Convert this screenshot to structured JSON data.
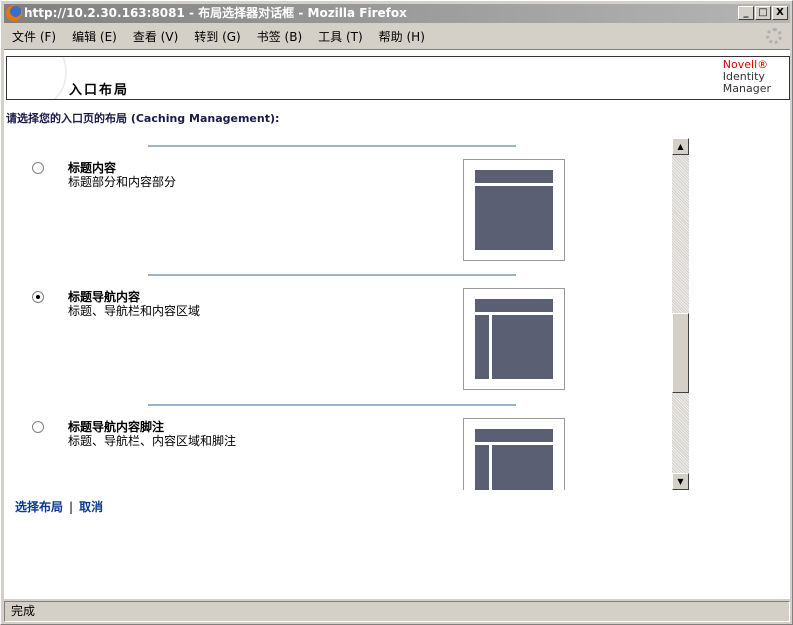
{
  "window": {
    "title": "http://10.2.30.163:8081 - 布局选择器对话框 - Mozilla Firefox",
    "min": "_",
    "max": "□",
    "close": "X"
  },
  "menu": [
    "文件 (F)",
    "编辑 (E)",
    "查看 (V)",
    "转到 (G)",
    "书签 (B)",
    "工具 (T)",
    "帮助 (H)"
  ],
  "header": {
    "title": "入口布局",
    "logo_brand": "Novell®",
    "logo_line1": "Identity",
    "logo_line2": "Manager"
  },
  "prompt": "请选择您的入口页的布局 (Caching Management):",
  "options": [
    {
      "title": "标题内容",
      "desc": "标题部分和内容部分",
      "selected": false
    },
    {
      "title": "标题导航内容",
      "desc": "标题、导航栏和内容区域",
      "selected": true
    },
    {
      "title": "标题导航内容脚注",
      "desc": "标题、导航栏、内容区域和脚注",
      "selected": false
    }
  ],
  "actions": {
    "select": "选择布局",
    "separator": "|",
    "cancel": "取消"
  },
  "status": "完成"
}
